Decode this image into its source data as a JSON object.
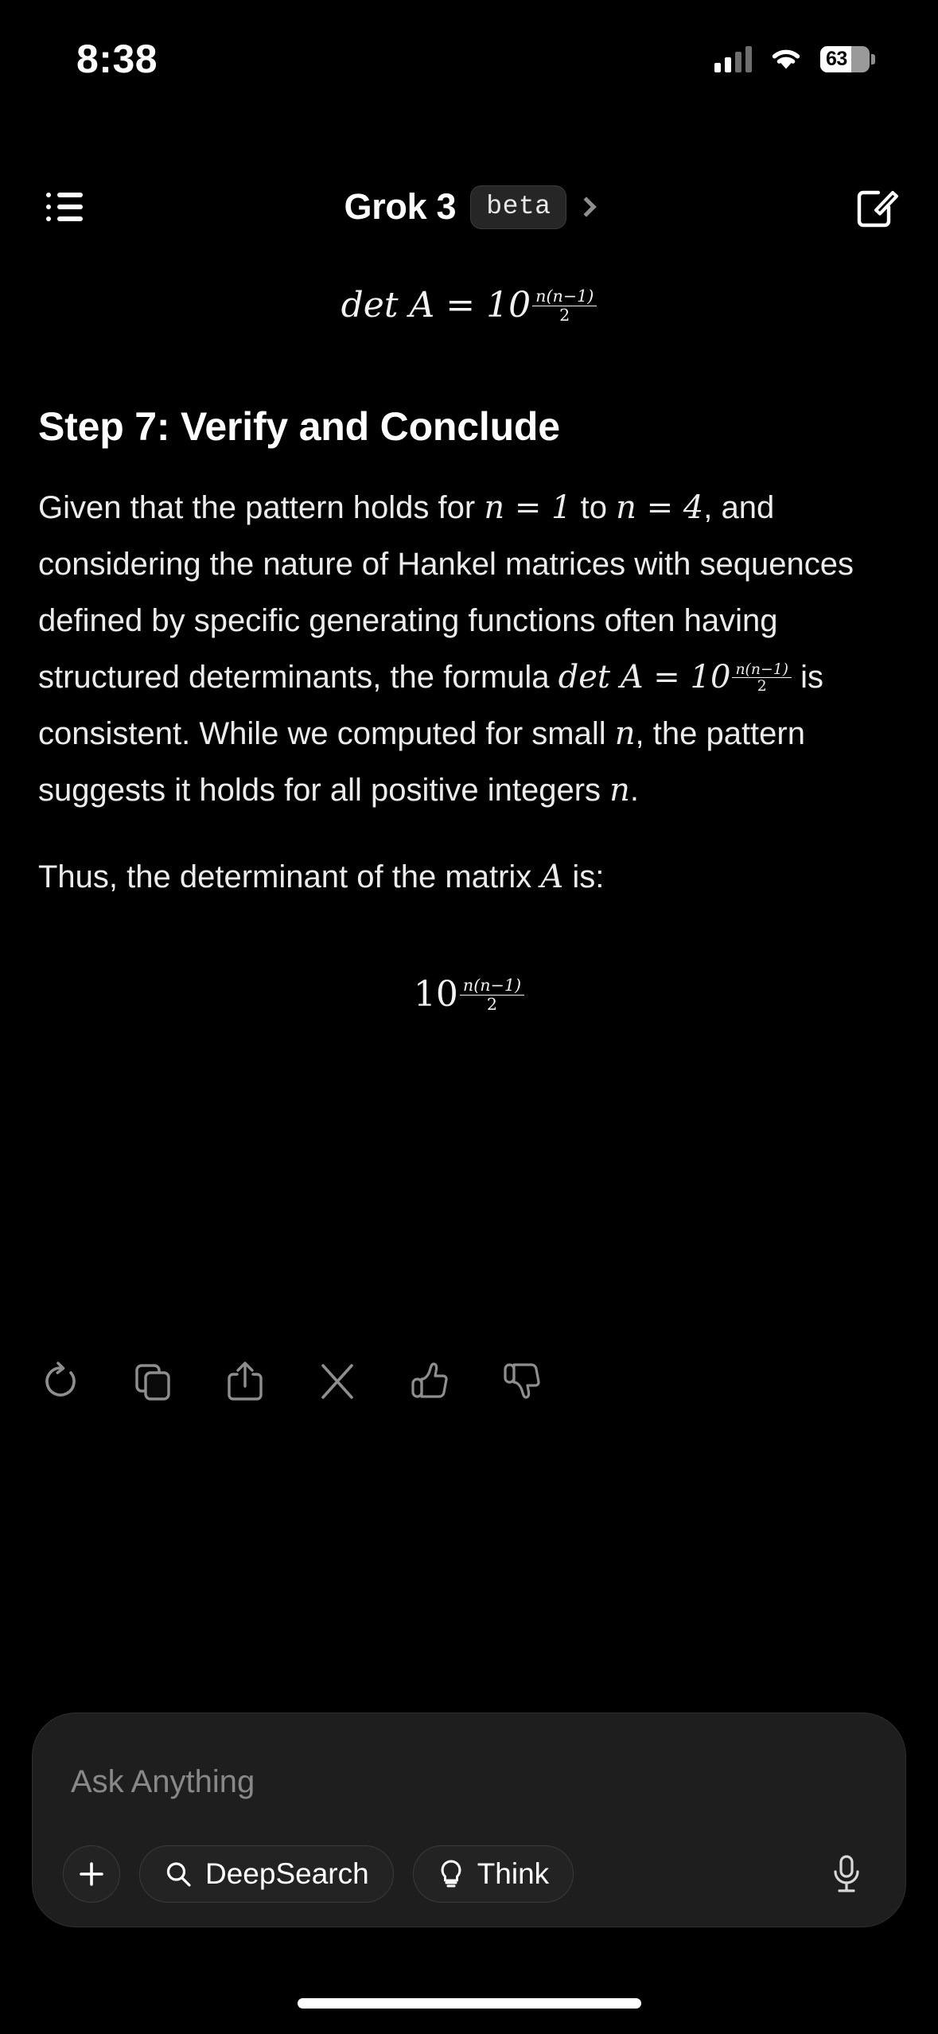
{
  "status_bar": {
    "time": "8:38",
    "battery_level": "63",
    "signal_icon": "cellular-bars-icon",
    "wifi_icon": "wifi-icon",
    "battery_icon": "battery-icon"
  },
  "header": {
    "menu_icon": "list-menu-icon",
    "title": "Grok 3",
    "badge": "beta",
    "chevron_icon": "chevron-right-icon",
    "compose_icon": "compose-icon"
  },
  "message": {
    "top_equation": {
      "lhs": "det A = 10",
      "exp_num": "n(n−1)",
      "exp_den": "2"
    },
    "step_title": "Step 7: Verify and Conclude",
    "paragraph_1": {
      "part_1": "Given that the pattern holds for ",
      "math_1": "n = 1",
      "part_2": " to ",
      "math_2": "n = 4",
      "part_3": ", and considering the nature of Hankel matrices with sequences defined by specific generating functions often having structured determinants, the formula ",
      "math_3_base": "det A = 10",
      "math_3_num": "n(n−1)",
      "math_3_den": "2",
      "part_4": " is consistent. While we computed for small ",
      "math_4": "n",
      "part_5": ", the pattern suggests it holds for all positive integers ",
      "math_5": "n",
      "part_6": "."
    },
    "paragraph_2": {
      "part_1": "Thus, the determinant of the matrix ",
      "math_1": "A",
      "part_2": " is:"
    },
    "final_equation": {
      "base": "10",
      "exp_num": "n(n−1)",
      "exp_den": "2"
    }
  },
  "actions": [
    {
      "name": "regenerate-icon",
      "label": "Regenerate"
    },
    {
      "name": "copy-icon",
      "label": "Copy"
    },
    {
      "name": "share-icon",
      "label": "Share"
    },
    {
      "name": "x-icon",
      "label": "Post on X"
    },
    {
      "name": "thumbs-up-icon",
      "label": "Good response"
    },
    {
      "name": "thumbs-down-icon",
      "label": "Bad response"
    }
  ],
  "composer": {
    "placeholder": "Ask Anything",
    "attach_label": "+",
    "deepsearch_label": "DeepSearch",
    "think_label": "Think",
    "mic_icon": "microphone-icon",
    "search_icon": "search-icon",
    "bulb_icon": "lightbulb-icon"
  },
  "colors": {
    "background": "#000000",
    "surface": "#1e1e1e",
    "border": "#2e2e2e",
    "text_primary": "#ececec",
    "text_muted": "#888888",
    "icon_muted": "#8e8e8e"
  }
}
